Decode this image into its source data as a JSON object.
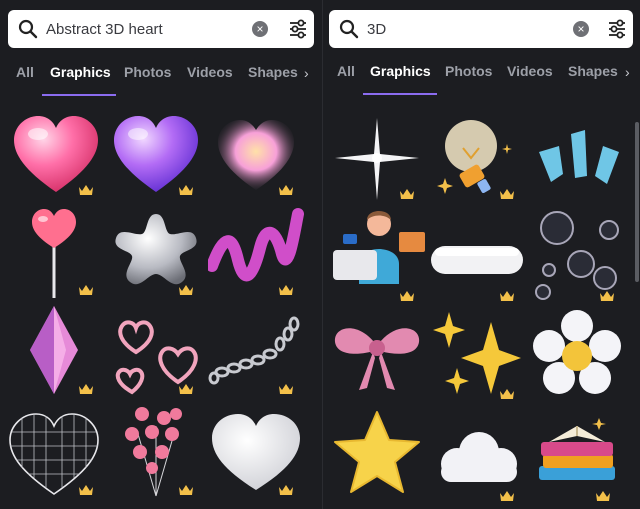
{
  "left_panel": {
    "search": {
      "query": "Abstract 3D heart"
    },
    "tabs": [
      {
        "label": "All",
        "active": false
      },
      {
        "label": "Graphics",
        "active": true
      },
      {
        "label": "Photos",
        "active": false
      },
      {
        "label": "Videos",
        "active": false
      },
      {
        "label": "Shapes",
        "active": false
      }
    ]
  },
  "right_panel": {
    "search": {
      "query": "3D"
    },
    "tabs": [
      {
        "label": "All",
        "active": false
      },
      {
        "label": "Graphics",
        "active": true
      },
      {
        "label": "Photos",
        "active": false
      },
      {
        "label": "Videos",
        "active": false
      },
      {
        "label": "Shapes",
        "active": false
      }
    ]
  },
  "icons": {
    "search": "search-icon",
    "clear": "clear-icon",
    "filter": "filter-icon",
    "next": "chevron-right-icon",
    "premium": "crown-icon"
  },
  "colors": {
    "background": "#1c1d21",
    "accent": "#8b6cf0",
    "premium_crown": "#f3c04a"
  }
}
